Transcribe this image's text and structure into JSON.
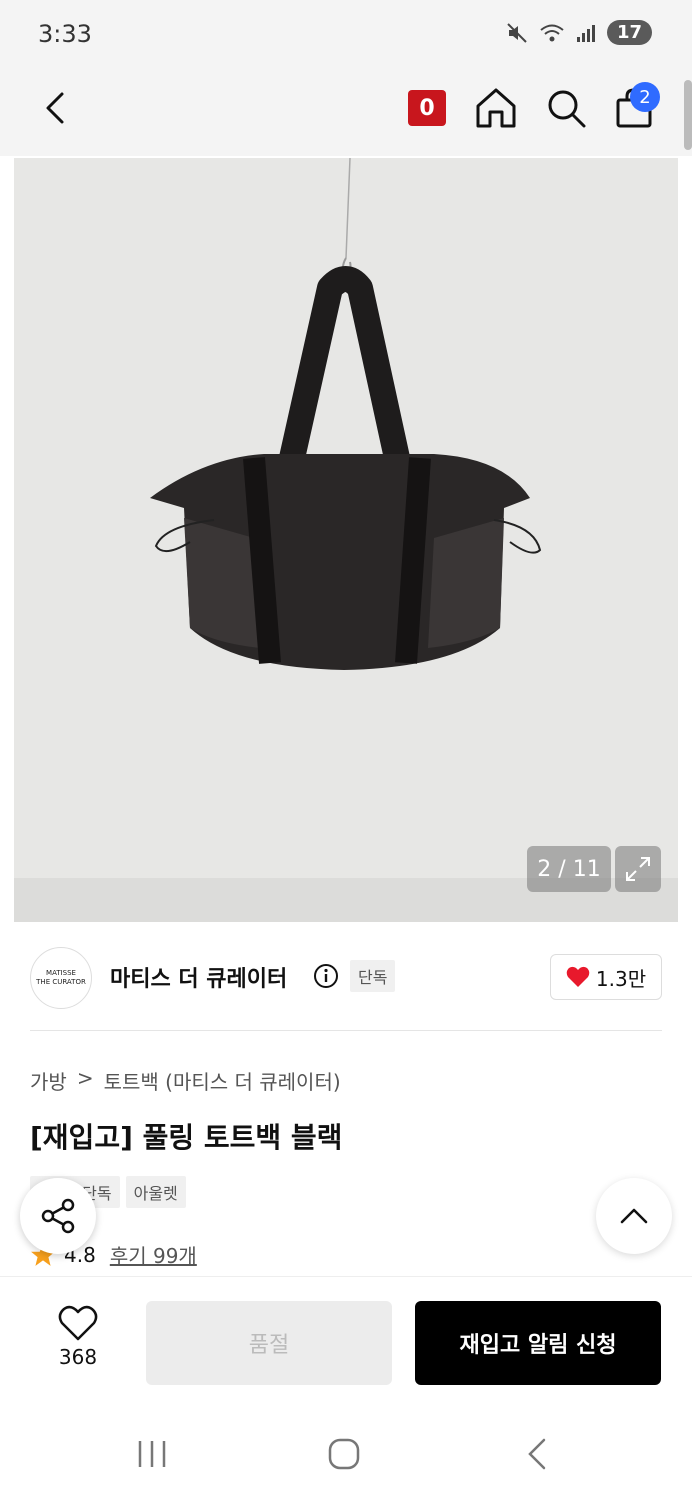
{
  "status_bar": {
    "time": "3:33",
    "battery": "17"
  },
  "top_bar": {
    "coupon_count": "0",
    "cart_count": "2"
  },
  "gallery": {
    "page_indicator": "2 / 11"
  },
  "brand": {
    "logo_line1": "MATISSE",
    "logo_line2": "THE CURATOR",
    "name": "마티스 더 큐레이터",
    "exclusive_tag": "단독",
    "likes": "1.3만"
  },
  "breadcrumb": {
    "category": "가방",
    "separator": ">",
    "subcategory": "토트백 (마티스 더 큐레이터)"
  },
  "product": {
    "title": "[재입고] 풀링 토트백 블랙"
  },
  "tags": [
    "무신사단독",
    "아울렛"
  ],
  "rating": {
    "score": "4.8",
    "reviews": "후기 99개"
  },
  "bottom_bar": {
    "wish_count": "368",
    "soldout_label": "품절",
    "restock_label": "재입고 알림 신청"
  },
  "colors": {
    "accent_red": "#c8161d",
    "cart_badge_blue": "#2f6bff",
    "heart_red": "#e8192c",
    "star_orange": "#f7a01d"
  }
}
